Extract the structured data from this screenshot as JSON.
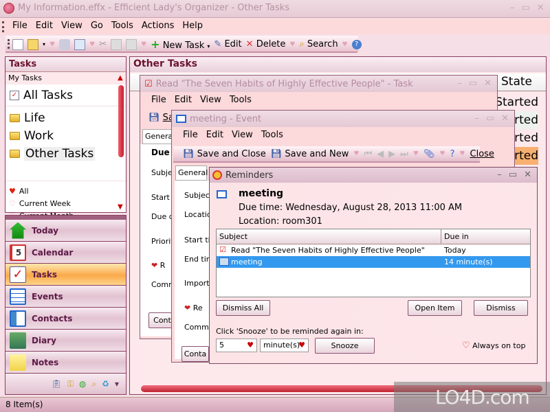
{
  "window": {
    "title": "My Information.effx - Efficient Lady's Organizer - Other Tasks"
  },
  "menu": [
    "File",
    "Edit",
    "View",
    "Go",
    "Tools",
    "Actions",
    "Help"
  ],
  "toolbar": {
    "new_task": "New Task",
    "edit": "Edit",
    "delete": "Delete",
    "search": "Search"
  },
  "tasks_pane": {
    "title": "Tasks",
    "group": "My Tasks",
    "folders": [
      "All Tasks",
      "Life",
      "Work",
      "Other Tasks"
    ],
    "filters": [
      "All",
      "Current Week",
      "Current Month"
    ]
  },
  "nav": [
    "Today",
    "Calendar",
    "Tasks",
    "Events",
    "Contacts",
    "Diary",
    "Notes"
  ],
  "nav_active": "Tasks",
  "status": {
    "items": "8 Item(s)"
  },
  "main": {
    "title": "Other Tasks",
    "state_header": "State",
    "states": [
      "Started",
      "rted",
      "rted",
      "rted"
    ]
  },
  "task_window": {
    "title": "Read \"The Seven Habits of Highly Effective People\" - Task",
    "menu": [
      "File",
      "Edit",
      "View",
      "Tools"
    ],
    "save_partial": "Sa",
    "tab": "General",
    "due_label": "Due l",
    "labels": [
      "Subjec",
      "Start d",
      "Due d",
      "Priority",
      "R",
      "Comm",
      "Cont"
    ]
  },
  "event_window": {
    "title": "meeting - Event",
    "menu": [
      "File",
      "Edit",
      "View",
      "Tools"
    ],
    "save_close": "Save and Close",
    "save_new": "Save and New",
    "close": "Close",
    "tab": "General",
    "labels": [
      "Subject",
      "Locatio",
      "Start tim",
      "End tim",
      "Importa",
      "Re",
      "Comme",
      "Conta"
    ]
  },
  "reminders": {
    "title": "Reminders",
    "subject": "meeting",
    "due_time": "Due time: Wednesday, August 28, 2013 11:00 AM",
    "location": "Location: room301",
    "columns": [
      "Subject",
      "Due in"
    ],
    "rows": [
      {
        "subject": "Read \"The Seven Habits of Highly Effective People\"",
        "due": "Today",
        "selected": false
      },
      {
        "subject": "meeting",
        "due": "14 minute(s)",
        "selected": true
      }
    ],
    "dismiss_all": "Dismiss All",
    "open_item": "Open Item",
    "dismiss": "Dismiss",
    "snooze_prompt": "Click 'Snooze' to be reminded again in:",
    "snooze_value": "5",
    "snooze_unit": "minute(s)",
    "snooze": "Snooze",
    "always_on_top": "Always on top"
  },
  "watermark": "LO4D.com"
}
